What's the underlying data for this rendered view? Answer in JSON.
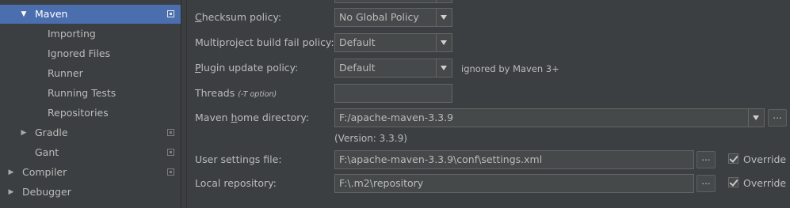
{
  "sidebar": {
    "items": [
      {
        "label": "Maven",
        "arrow": "▼",
        "selected": true
      },
      {
        "label": "Importing"
      },
      {
        "label": "Ignored Files"
      },
      {
        "label": "Runner"
      },
      {
        "label": "Running Tests"
      },
      {
        "label": "Repositories"
      },
      {
        "label": "Gradle",
        "arrow": "▶"
      },
      {
        "label": "Gant"
      },
      {
        "label": "Compiler",
        "arrow": "▶"
      },
      {
        "label": "Debugger",
        "arrow": "▶"
      }
    ]
  },
  "form": {
    "checksum_policy": {
      "label_mn": "C",
      "label_rest": "hecksum policy:",
      "value": "No Global Policy"
    },
    "multiproject_policy": {
      "label": "Multiproject build fail policy:",
      "value": "Default"
    },
    "plugin_update_policy": {
      "label_mn": "P",
      "label_rest": "lugin update policy:",
      "value": "Default",
      "note": "ignored by Maven 3+"
    },
    "threads": {
      "label": "Threads",
      "hint": "(-T option)",
      "value": ""
    },
    "maven_home": {
      "label_pre": "Maven ",
      "label_mn": "h",
      "label_rest": "ome directory:",
      "value": "F:/apache-maven-3.3.9",
      "version": "(Version: 3.3.9)"
    },
    "user_settings": {
      "label": "User settings file:",
      "value": "F:\\apache-maven-3.3.9\\conf\\settings.xml",
      "override_label": "Override",
      "override_checked": true
    },
    "local_repository": {
      "label": "Local repository:",
      "value": "F:\\.m2\\repository",
      "override_label": "Override",
      "override_checked": true
    },
    "browse_label": "..."
  },
  "colors": {
    "background": "#3c3f41",
    "selection": "#4b6eaf",
    "field": "#45494a",
    "text": "#bbbbbb"
  }
}
